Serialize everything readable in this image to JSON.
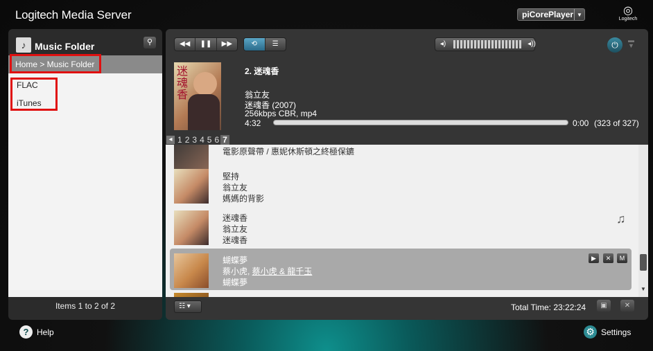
{
  "header": {
    "brand": "Logitech",
    "brand_suffix": "Media Server",
    "player_name": "piCorePlayer",
    "logo_text": "Logitech"
  },
  "left": {
    "title": "Music Folder",
    "breadcrumb": "Home > Music Folder",
    "items": [
      "FLAC",
      "iTunes"
    ],
    "footer": "Items 1 to 2 of 2"
  },
  "now_playing": {
    "track": "2. 迷魂香",
    "artist": "翁立友",
    "album": "迷魂香 (2007)",
    "format": "256kbps CBR, mp4",
    "duration": "4:32",
    "elapsed": "0:00",
    "count": "(323 of 327)",
    "progress": 0.0
  },
  "pager": {
    "pages": [
      "1",
      "2",
      "3",
      "4",
      "5",
      "6"
    ],
    "current": "7"
  },
  "playlist": [
    {
      "title": "…",
      "sub": "電影原聲帶 / 惠妮休斯頓之終極保鑣",
      "sub2": ""
    },
    {
      "title": "堅持",
      "sub": "翁立友",
      "sub2": "媽媽的背影"
    },
    {
      "title": "迷魂香",
      "sub": "翁立友",
      "sub2": "迷魂香"
    },
    {
      "title": "蝴蝶夢",
      "sub_a": "蔡小虎, ",
      "sub_b": "蔡小虎 & 龍千玉",
      "sub2": "蝴蝶夢"
    }
  ],
  "footer": {
    "total_time": "Total Time: 23:22:24"
  },
  "bottom": {
    "help": "Help",
    "settings": "Settings"
  }
}
